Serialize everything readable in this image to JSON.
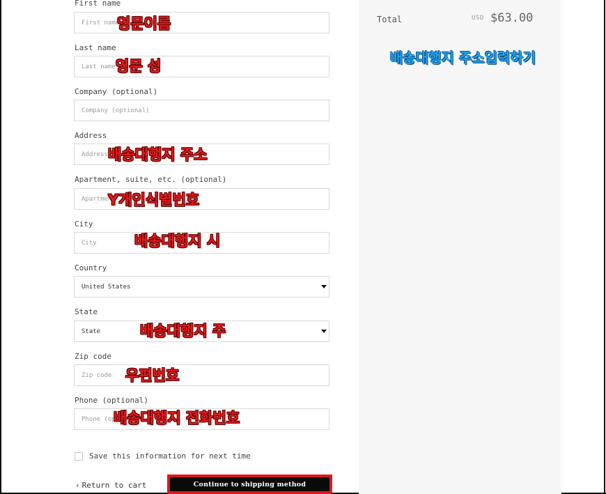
{
  "summary": {
    "total_label": "Total",
    "currency": "USD",
    "total_amount": "$63.00"
  },
  "fields": {
    "first_name": {
      "label": "First name",
      "placeholder": "First name"
    },
    "last_name": {
      "label": "Last name",
      "placeholder": "Last name"
    },
    "company": {
      "label": "Company (optional)",
      "placeholder": "Company (optional)"
    },
    "address": {
      "label": "Address",
      "placeholder": "Address"
    },
    "apartment": {
      "label": "Apartment, suite, etc. (optional)",
      "placeholder": "Apartment"
    },
    "city": {
      "label": "City",
      "placeholder": "City"
    },
    "country": {
      "label": "Country",
      "value": "United States"
    },
    "state": {
      "label": "State",
      "value": "State"
    },
    "zip": {
      "label": "Zip code",
      "placeholder": "Zip code"
    },
    "phone": {
      "label": "Phone (optional)",
      "placeholder": "Phone (optional)"
    }
  },
  "save_info_label": "Save this information for next time",
  "return_link_label": "Return to cart",
  "continue_label": "Continue to shipping method",
  "icons": {
    "return": "chevron-left-icon",
    "select": "caret-down-icon"
  },
  "colors": {
    "annotation_red": "#e41a1c",
    "annotation_blue": "#21a1ea",
    "button_bg": "#0a0a0a",
    "highlight_border": "#e0171b"
  },
  "annotations": {
    "first_name": "영문이름",
    "last_name": "영문 성",
    "address": "배송대행지 주소",
    "apartment": "Y개인식별번호",
    "city": "배송대행지 시",
    "state": "배송대행지 주",
    "zip": "우편번호",
    "phone": "배송대행지 전화번호",
    "title": "배송대행지 주소입력하기"
  }
}
